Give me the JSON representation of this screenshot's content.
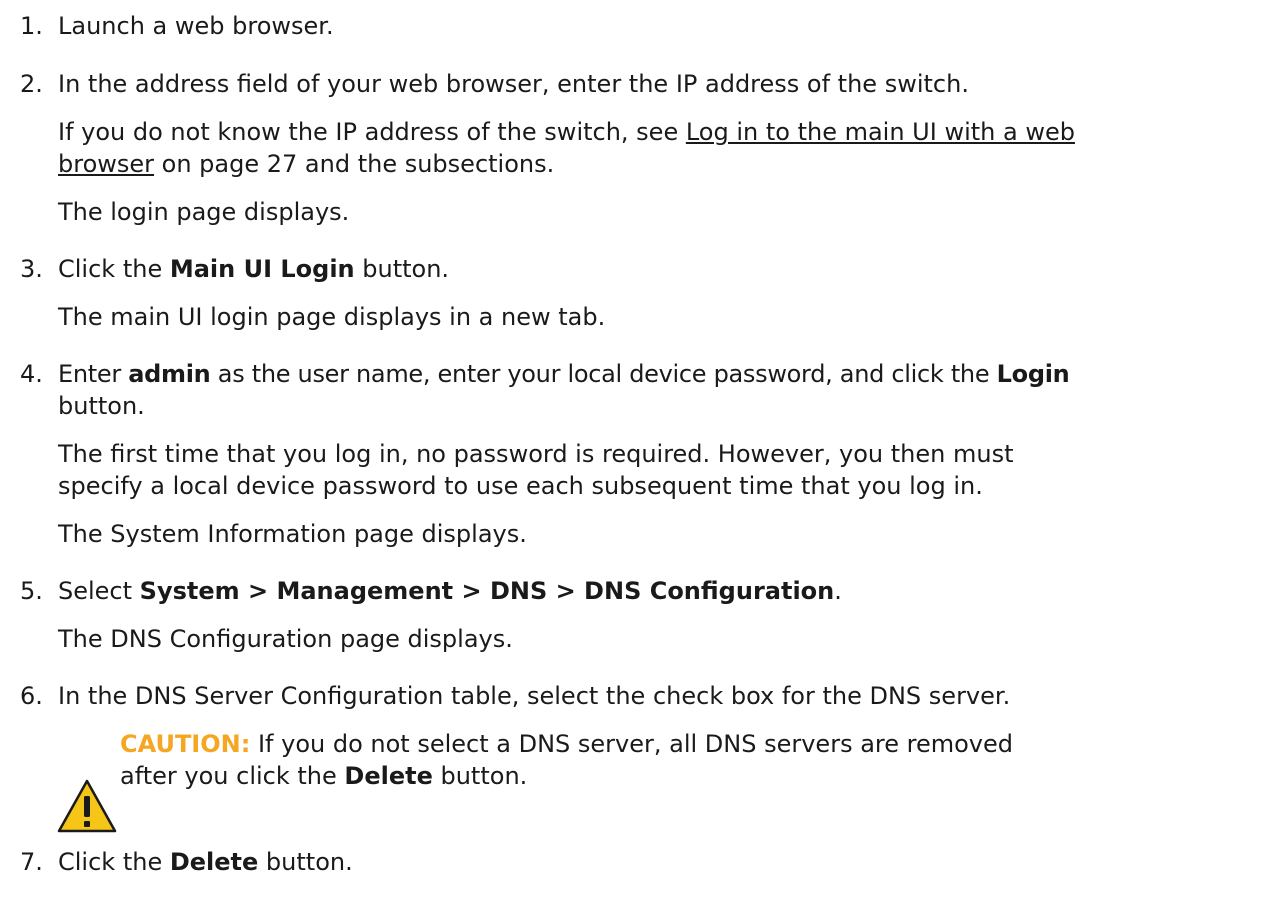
{
  "steps": [
    {
      "number": "1.",
      "text": "Launch a web browser."
    },
    {
      "number": "2.",
      "text": "In the address field of your web browser, enter the IP address of the switch.",
      "note1_a": "If you do not know the IP address of the switch, see ",
      "note1_link1": "Log in to the main UI with a web",
      "note1_link2": "browser",
      "note1_b": " on page 27 and the subsections.",
      "note2": "The login page displays."
    },
    {
      "number": "3.",
      "text_a": "Click the ",
      "bold": "Main UI Login",
      "text_b": " button.",
      "note": "The main UI login page displays in a new tab."
    },
    {
      "number": "4.",
      "text_a": "Enter ",
      "bold1": "admin",
      "text_b": " as the user name, enter your local device password, and click the ",
      "bold2": "Login",
      "text_c": "button.",
      "note1_a": "The first time that you log in, no password is required. However, you then must",
      "note1_b": "specify a local device password to use each subsequent time that you log in.",
      "note2": "The System Information page displays."
    },
    {
      "number": "5.",
      "text_a": "Select ",
      "bold": "System > Management > DNS > DNS Configuration",
      "text_b": ".",
      "note": "The DNS Configuration page displays."
    },
    {
      "number": "6.",
      "text": "In the DNS Server Configuration table, select the check box for the DNS server.",
      "caution_label": "CAUTION:",
      "caution_a": " If you do not select a DNS server, all DNS servers are removed",
      "caution_b": "after you click the ",
      "caution_bold": "Delete",
      "caution_c": " button."
    },
    {
      "number": "7.",
      "text_a": "Click the ",
      "bold": "Delete",
      "text_b": " button."
    }
  ],
  "colors": {
    "caution": "#f5a623",
    "text": "#1a1a1a"
  },
  "icons": {
    "caution": "warning-triangle-icon"
  }
}
